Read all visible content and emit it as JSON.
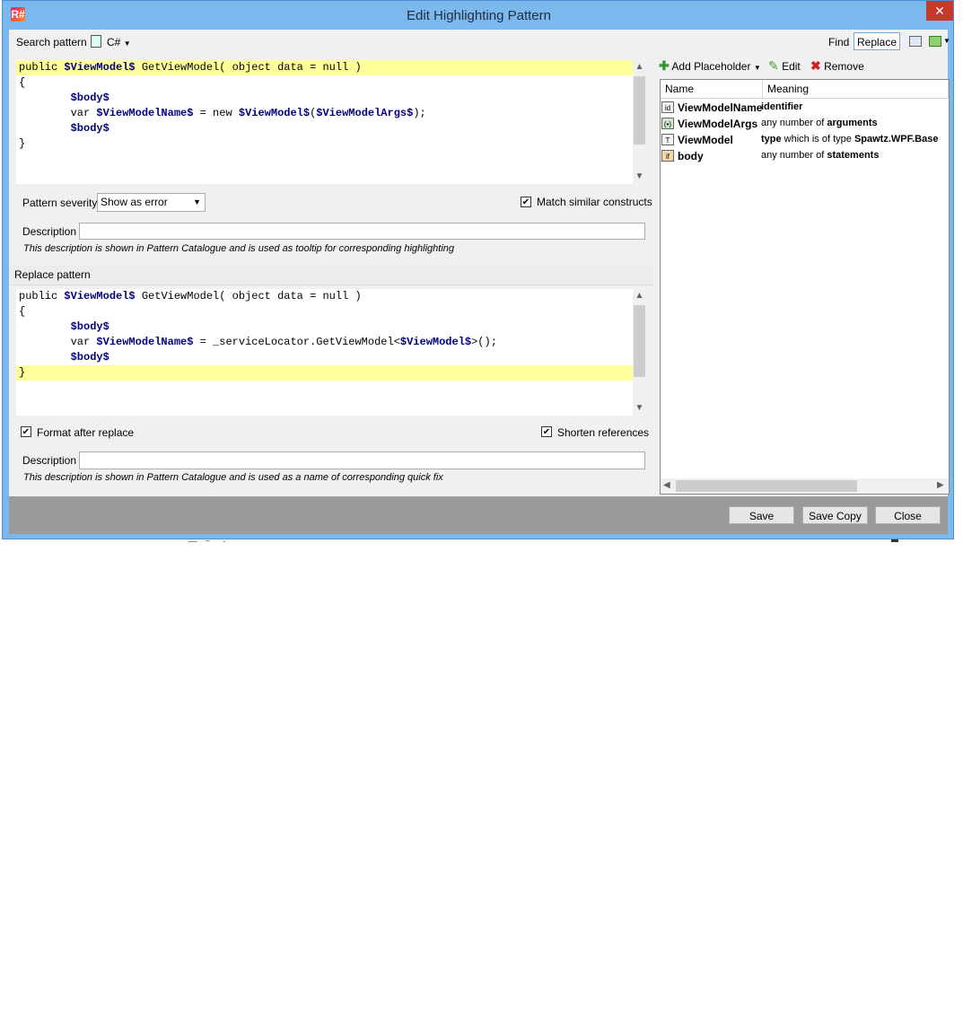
{
  "window": {
    "title": "Edit Highlighting Pattern",
    "app_icon": "R#",
    "close_glyph": "✕"
  },
  "search": {
    "label": "Search pattern",
    "language": "C#",
    "find_label": "Find",
    "replace_label": "Replace",
    "lines": [
      [
        {
          "t": "public ",
          "p": false
        },
        {
          "t": "$ViewModel$",
          "p": true
        },
        {
          "t": " GetViewModel( object data = null )",
          "p": false
        }
      ],
      [
        {
          "t": "{",
          "p": false
        }
      ],
      [
        {
          "t": "        ",
          "p": false
        },
        {
          "t": "$body$",
          "p": true
        }
      ],
      [
        {
          "t": "        var ",
          "p": false
        },
        {
          "t": "$ViewModelName$",
          "p": true
        },
        {
          "t": " = new ",
          "p": false
        },
        {
          "t": "$ViewModel$",
          "p": true
        },
        {
          "t": "(",
          "p": false
        },
        {
          "t": "$ViewModelArgs$",
          "p": true
        },
        {
          "t": ");",
          "p": false
        }
      ],
      [
        {
          "t": "        ",
          "p": false
        },
        {
          "t": "$body$",
          "p": true
        }
      ],
      [
        {
          "t": "}",
          "p": false
        }
      ]
    ],
    "highlight_line": 0
  },
  "severity": {
    "label": "Pattern severity",
    "value": "Show as error",
    "match_similar_label": "Match similar constructs",
    "match_similar_checked": true
  },
  "search_description": {
    "label": "Description",
    "value": "",
    "hint": "This description is shown in Pattern Catalogue and is used as tooltip for corresponding highlighting"
  },
  "replace": {
    "label": "Replace pattern",
    "lines": [
      [
        {
          "t": "public ",
          "p": false
        },
        {
          "t": "$ViewModel$",
          "p": true
        },
        {
          "t": " GetViewModel( object data = null )",
          "p": false
        }
      ],
      [
        {
          "t": "{",
          "p": false
        }
      ],
      [
        {
          "t": "        ",
          "p": false
        },
        {
          "t": "$body$",
          "p": true
        }
      ],
      [
        {
          "t": "        var ",
          "p": false
        },
        {
          "t": "$ViewModelName$",
          "p": true
        },
        {
          "t": " = _serviceLocator.GetViewModel<",
          "p": false
        },
        {
          "t": "$ViewModel$",
          "p": true
        },
        {
          "t": ">();",
          "p": false
        }
      ],
      [
        {
          "t": "        ",
          "p": false
        },
        {
          "t": "$body$",
          "p": true
        }
      ],
      [
        {
          "t": "}",
          "p": false
        }
      ]
    ],
    "highlight_line": 5,
    "format_after_label": "Format after replace",
    "format_after_checked": true,
    "shorten_refs_label": "Shorten references",
    "shorten_refs_checked": true
  },
  "replace_description": {
    "label": "Description",
    "value": "",
    "hint": "This description is shown in Pattern Catalogue and is used as a name of corresponding quick fix"
  },
  "placeholders": {
    "add_label": "Add Placeholder",
    "edit_label": "Edit",
    "remove_label": "Remove",
    "columns": [
      "Name",
      "Meaning"
    ],
    "rows": [
      {
        "icon": "identifier-icon",
        "glyph": "id",
        "name": "ViewModelName",
        "meaning": [
          {
            "t": "identifier",
            "b": true
          }
        ]
      },
      {
        "icon": "arguments-icon",
        "glyph": "(•)",
        "name": "ViewModelArgs",
        "meaning": [
          {
            "t": "any number of ",
            "b": false
          },
          {
            "t": "arguments",
            "b": true
          }
        ]
      },
      {
        "icon": "type-icon",
        "glyph": "T",
        "name": "ViewModel",
        "meaning": [
          {
            "t": "type",
            "b": true
          },
          {
            "t": " which is of type ",
            "b": false
          },
          {
            "t": "Spawtz.WPF.Base",
            "b": true
          }
        ]
      },
      {
        "icon": "statement-icon",
        "glyph": "if",
        "name": "body",
        "meaning": [
          {
            "t": "any number of ",
            "b": false
          },
          {
            "t": "statements",
            "b": true
          }
        ]
      }
    ]
  },
  "buttons": {
    "save": "Save",
    "save_copy": "Save Copy",
    "close": "Close"
  }
}
